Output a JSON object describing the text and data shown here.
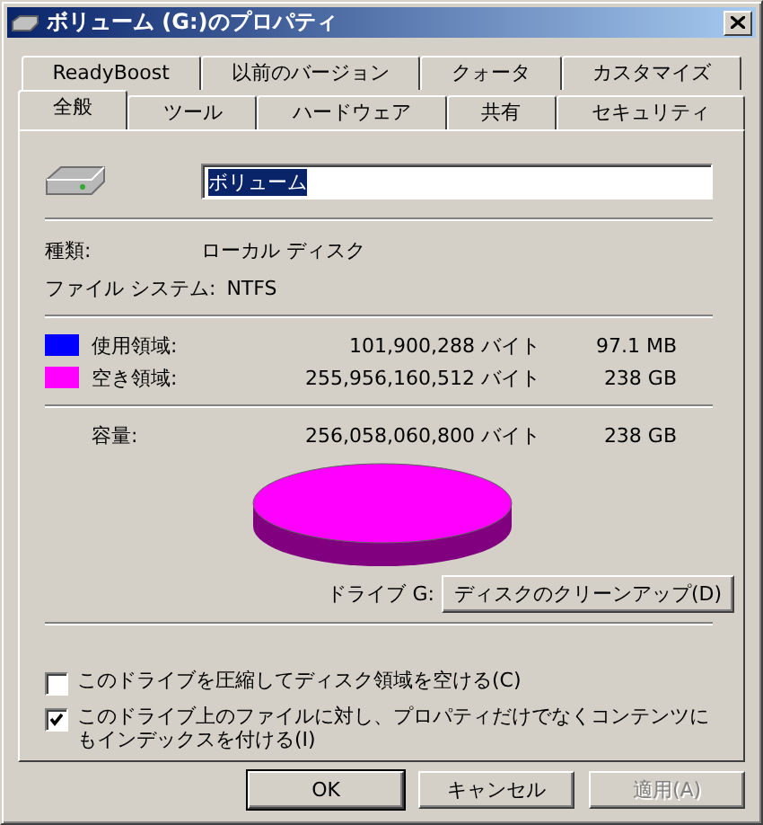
{
  "window": {
    "title": "ボリューム (G:)のプロパティ"
  },
  "tab_rows": [
    [
      {
        "label": "ReadyBoost",
        "selected": false
      },
      {
        "label": "以前のバージョン",
        "selected": false
      },
      {
        "label": "クォータ",
        "selected": false
      },
      {
        "label": "カスタマイズ",
        "selected": false
      }
    ],
    [
      {
        "label": "全般",
        "selected": true
      },
      {
        "label": "ツール",
        "selected": false
      },
      {
        "label": "ハードウェア",
        "selected": false
      },
      {
        "label": "共有",
        "selected": false
      },
      {
        "label": "セキュリティ",
        "selected": false
      }
    ]
  ],
  "volume_name": {
    "value": "ボリューム"
  },
  "info": [
    {
      "label": "種類:",
      "value": "ローカル ディスク"
    },
    {
      "label": "ファイル システム:",
      "value": "NTFS"
    }
  ],
  "usage": [
    {
      "label": "使用領域:",
      "bytes": "101,900,288 バイト",
      "size": "97.1 MB",
      "color": "#0000ff"
    },
    {
      "label": "空き領域:",
      "bytes": "255,956,160,512 バイト",
      "size": "238 GB",
      "color": "#ff00ff"
    }
  ],
  "capacity": {
    "label": "容量:",
    "bytes": "256,058,060,800 バイト",
    "size": "238 GB"
  },
  "drive_label": "ドライブ G:",
  "cleanup_button": "ディスクのクリーンアップ(D)",
  "options": [
    {
      "label": "このドライブを圧縮してディスク領域を空ける(C)",
      "checked": false
    },
    {
      "label": "このドライブ上のファイルに対し、プロパティだけでなくコンテンツにもインデックスを付ける(I)",
      "checked": true
    }
  ],
  "buttons": [
    {
      "label": "OK",
      "disabled": false,
      "default": true
    },
    {
      "label": "キャンセル",
      "disabled": false,
      "default": false
    },
    {
      "label": "適用(A)",
      "disabled": true,
      "default": false
    }
  ]
}
